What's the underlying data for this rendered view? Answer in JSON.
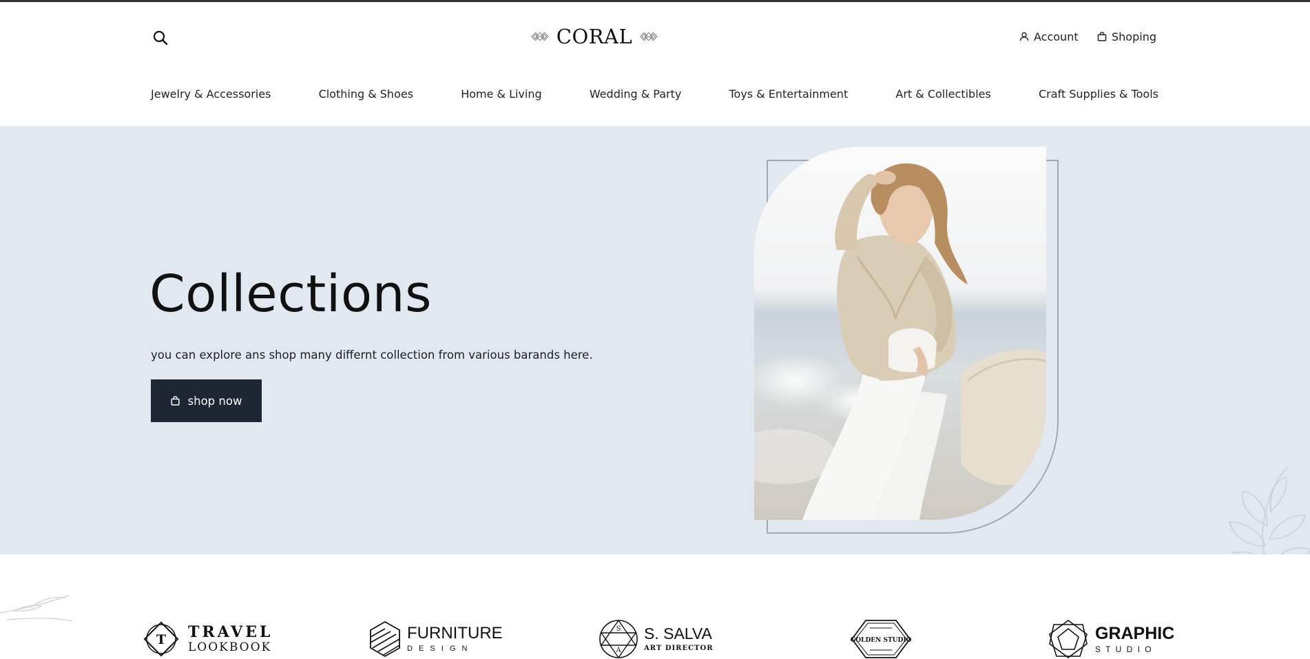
{
  "header": {
    "logo_text": "CORAL",
    "account_label": "Account",
    "cart_label": "Shoping",
    "icons": {
      "search": "search-icon",
      "account": "user-icon",
      "cart": "bag-icon"
    }
  },
  "nav": {
    "items": [
      "Jewelry & Accessories",
      "Clothing & Shoes",
      "Home & Living",
      "Wedding & Party",
      "Toys & Entertainment",
      "Art & Collectibles",
      "Craft Supplies & Tools"
    ]
  },
  "hero": {
    "title": "Collections",
    "subtitle": "you can explore ans shop many differnt collection from various barands here.",
    "button_label": "shop now",
    "background": "#e2e8f0",
    "button_color": "#1d2733"
  },
  "brands": [
    {
      "line1": "TRAVEL",
      "line2": "LOOKBOOK",
      "icon": "diamond-t-logo",
      "mark": "T"
    },
    {
      "line1": "FURNITURE",
      "line2": "D E S I G N",
      "icon": "hexagon-stripes-logo"
    },
    {
      "line1": "S. SALVA",
      "line2": "ART DIRECTOR",
      "icon": "circle-triangles-logo",
      "mark_top": "S",
      "mark_bottom": "A"
    },
    {
      "line1": "GOLDEN STUDIO",
      "icon": "octagon-badge-logo"
    },
    {
      "line1": "GRAPHIC",
      "line2": "S T U D I O",
      "icon": "geometric-star-logo"
    }
  ]
}
